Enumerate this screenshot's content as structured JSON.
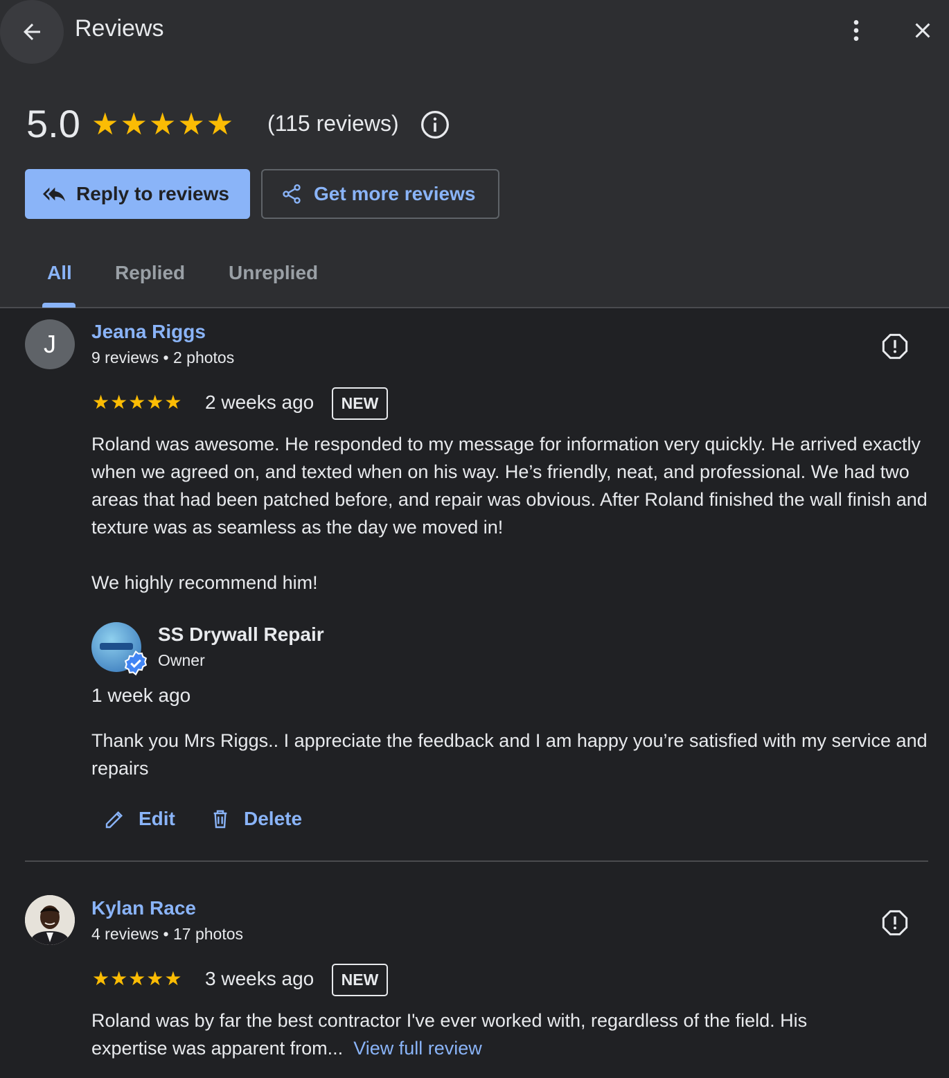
{
  "header": {
    "title": "Reviews",
    "rating_value": "5.0",
    "rating_stars": "★★★★★",
    "review_count": "(115 reviews)",
    "reply_button": "Reply to reviews",
    "get_more_button": "Get more reviews",
    "tabs": [
      {
        "label": "All",
        "selected": true
      },
      {
        "label": "Replied",
        "selected": false
      },
      {
        "label": "Unreplied",
        "selected": false
      }
    ]
  },
  "reviews": [
    {
      "avatar_letter": "J",
      "name": "Jeana Riggs",
      "meta": "9 reviews • 2 photos",
      "stars": "★★★★★",
      "time": "2 weeks ago",
      "badge": "NEW",
      "text_p1": "Roland was awesome. He responded to my message for information very quickly. He arrived exactly when we agreed on, and texted when on his way. He’s friendly, neat, and professional. We had two areas that had been patched before, and repair was obvious. After Roland finished the wall finish and texture was as seamless as the day we moved in!",
      "text_p2": "We highly recommend him!",
      "owner_reply": {
        "name": "SS Drywall Repair",
        "role": "Owner",
        "time": "1 week ago",
        "text": "Thank you Mrs Riggs.. I appreciate the feedback and I am happy you’re satisfied with my service and repairs",
        "edit_label": "Edit",
        "delete_label": "Delete"
      }
    },
    {
      "name": "Kylan Race",
      "meta": "4 reviews • 17 photos",
      "stars": "★★★★★",
      "time": "3 weeks ago",
      "badge": "NEW",
      "text": "Roland was by far the best contractor I've ever worked with, regardless of the field. His expertise was apparent from...",
      "view_full_label": "View full review"
    }
  ],
  "colors": {
    "background": "#202124",
    "header_background": "#2d2e31",
    "accent": "#8ab4f8",
    "star": "#fbbc04",
    "text": "#e8eaed"
  }
}
